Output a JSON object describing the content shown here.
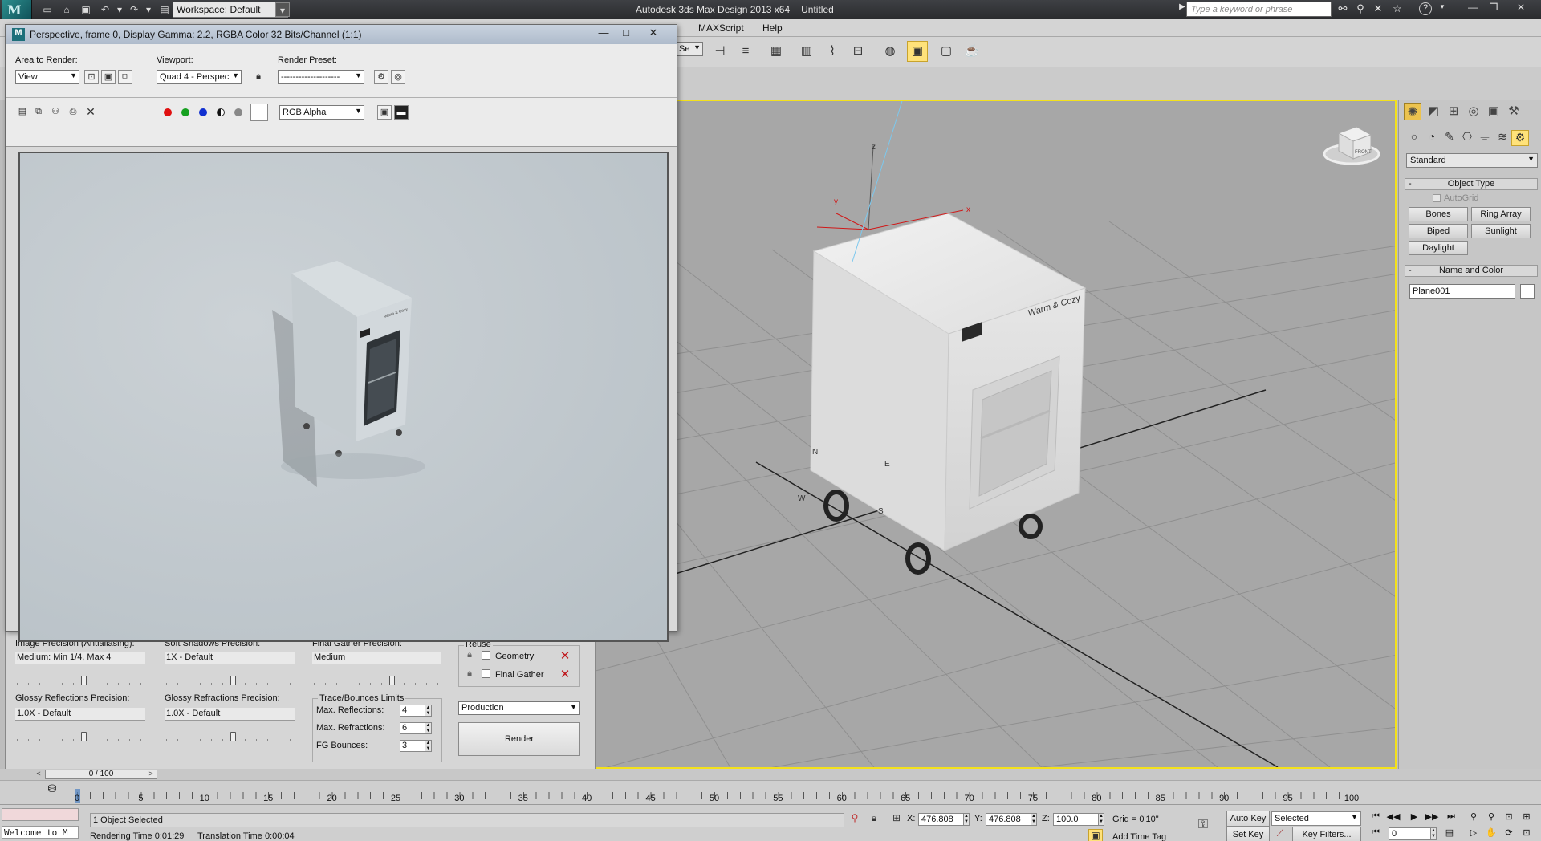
{
  "titlebar": {
    "logo_letter": "M",
    "workspace": "Workspace: Default",
    "app_name": "Autodesk 3ds Max Design 2013 x64",
    "file_name": "Untitled",
    "search_placeholder": "Type a keyword or phrase",
    "help_label": "?"
  },
  "menubar": {
    "items": [
      "MAXScript",
      "Help"
    ]
  },
  "maintoolbar": {
    "partial_dropdown": "Se"
  },
  "viewport": {
    "model_logo": "Warm & Cozy",
    "axis_labels": {
      "z": "z",
      "y": "y",
      "x": "x"
    },
    "compass": {
      "n": "N",
      "e": "E",
      "s": "S",
      "w": "W"
    },
    "viewcube_label": "FRONT"
  },
  "command_panel": {
    "category": "Standard",
    "object_type_title": "Object Type",
    "autogrid_label": "AutoGrid",
    "buttons": [
      "Bones",
      "Ring Array",
      "Biped",
      "Sunlight",
      "Daylight"
    ],
    "name_color_title": "Name and Color",
    "object_name": "Plane001"
  },
  "render_window": {
    "title": "Perspective, frame 0, Display Gamma: 2.2, RGBA Color 32 Bits/Channel (1:1)",
    "area_to_render_label": "Area to Render:",
    "area_to_render_value": "View",
    "viewport_label": "Viewport:",
    "viewport_value": "Quad 4 - Perspec",
    "render_preset_label": "Render Preset:",
    "render_preset_value": "--------------------",
    "channel_value": "RGB Alpha",
    "image_logo": "Warm & Cozy",
    "channel_colors": {
      "red": "#e01010",
      "green": "#16a020",
      "blue": "#1030d0"
    }
  },
  "render_settings": {
    "image_precision_label": "Image Precision (Antialiasing):",
    "image_precision_value": "Medium: Min 1/4, Max 4",
    "soft_shadows_label": "Soft Shadows Precision:",
    "soft_shadows_value": "1X - Default",
    "final_gather_label": "Final Gather Precision:",
    "final_gather_value": "Medium",
    "glossy_reflections_label": "Glossy Reflections Precision:",
    "glossy_reflections_value": "1.0X - Default",
    "glossy_refractions_label": "Glossy Refractions Precision:",
    "glossy_refractions_value": "1.0X - Default",
    "reuse_title": "Reuse",
    "reuse_geometry": "Geometry",
    "reuse_final_gather": "Final Gather",
    "trace_title": "Trace/Bounces Limits",
    "max_reflections_label": "Max. Reflections:",
    "max_reflections_value": "4",
    "max_refractions_label": "Max. Refractions:",
    "max_refractions_value": "6",
    "fg_bounces_label": "FG Bounces:",
    "fg_bounces_value": "3",
    "mode_value": "Production",
    "render_button": "Render"
  },
  "timeline": {
    "frame_counter": "0 / 100",
    "ticks": [
      "0",
      "5",
      "10",
      "15",
      "20",
      "25",
      "30",
      "35",
      "40",
      "45",
      "50",
      "55",
      "60",
      "65",
      "70",
      "75",
      "80",
      "85",
      "90",
      "95",
      "100"
    ]
  },
  "statusbar": {
    "listener_text": "Welcome to M",
    "selection": "1 Object Selected",
    "rendering_time": "Rendering Time  0:01:29",
    "translation_time": "Translation Time  0:00:04",
    "x_label": "X:",
    "x_value": "476.808",
    "y_label": "Y:",
    "y_value": "476.808",
    "z_label": "Z:",
    "z_value": "100.0",
    "grid": "Grid = 0'10\"",
    "add_time_tag": "Add Time Tag",
    "auto_key": "Auto Key",
    "set_key": "Set Key",
    "selected_value": "Selected",
    "key_filters": "Key Filters...",
    "current_frame": "0"
  }
}
